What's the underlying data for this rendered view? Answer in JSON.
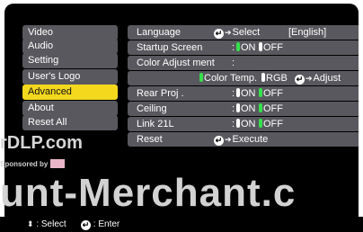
{
  "sidebar": {
    "items": [
      {
        "label": "Video"
      },
      {
        "label": "Audio"
      },
      {
        "label": "Setting"
      },
      {
        "label": "User's Logo"
      },
      {
        "label": "Advanced"
      },
      {
        "label": "About"
      },
      {
        "label": "Reset All"
      }
    ],
    "active": "Advanced"
  },
  "rows": {
    "language": {
      "label": "Language",
      "action": "Select",
      "value": "[English]"
    },
    "startup_screen": {
      "label": "Startup Screen",
      "colon": ":",
      "on": "ON",
      "off": "OFF"
    },
    "color_adjust": {
      "label": "Color Adjust ment",
      "colon": ":"
    },
    "color_sub": {
      "color_temp": "Color Temp.",
      "rgb": "RGB",
      "action": "Adjust"
    },
    "rear_proj": {
      "label": "Rear Proj .",
      "colon": ":",
      "on": "ON",
      "off": "OFF"
    },
    "ceiling": {
      "label": "Ceiling",
      "colon": ":",
      "on": "ON",
      "off": "OFF"
    },
    "link21l": {
      "label": "Link 21L",
      "colon": ":",
      "on": "ON",
      "off": "OFF"
    },
    "reset": {
      "label": "Reset",
      "action": "Execute"
    }
  },
  "footer": {
    "select_label": ": Select",
    "enter_label": ": Enter"
  },
  "watermark": {
    "line1": "rDLP.com",
    "line2": "Sponsored by",
    "line3": "unt-Merchant.c"
  },
  "colors": {
    "highlight": "#f3d81e",
    "item_bg": "#58585e",
    "selected_dot": "#36e04c",
    "unselected_dot": "#ffffff",
    "background": "#000000"
  },
  "icons": {
    "enter": "enter-icon",
    "arrow": "arrow-right-icon",
    "updown": "up-down-arrow-icon"
  }
}
